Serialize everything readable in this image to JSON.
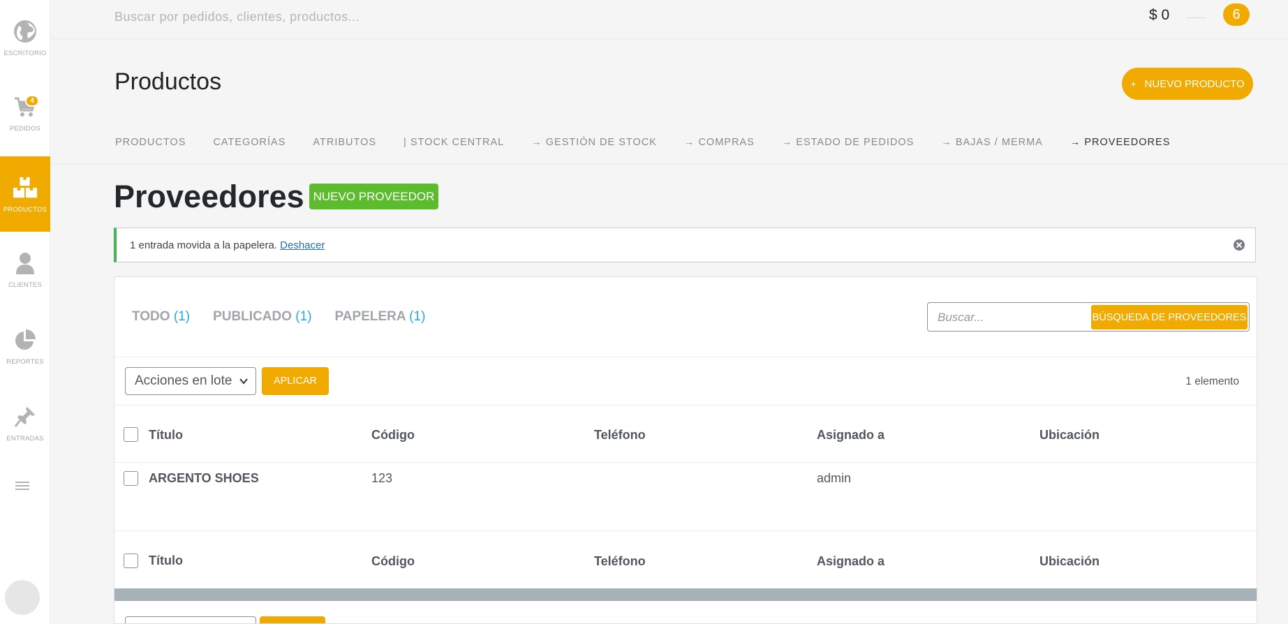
{
  "sidebar": {
    "items": [
      {
        "label": "Escritorio",
        "icon": "globe-icon"
      },
      {
        "label": "Pedidos",
        "icon": "cart-icon",
        "badge": "4"
      },
      {
        "label": "Productos",
        "icon": "boxes-icon",
        "active": true
      },
      {
        "label": "Clientes",
        "icon": "user-icon"
      },
      {
        "label": "Reportes",
        "icon": "pie-chart-icon"
      },
      {
        "label": "Entradas",
        "icon": "pin-icon"
      }
    ]
  },
  "topbar": {
    "search_placeholder": "Buscar por pedidos, clientes, productos...",
    "money": "$ 0",
    "count": "6"
  },
  "header": {
    "title": "Productos",
    "new_product_plus": "+",
    "new_product_label": "NUEVO PRODUCTO"
  },
  "subnav": {
    "items": [
      "PRODUCTOS",
      "CATEGORÍAS",
      "ATRIBUTOS",
      "| STOCK CENTRAL",
      "→ GESTIÓN DE STOCK",
      "→ COMPRAS",
      "→ ESTADO DE PEDIDOS",
      "→ BAJAS / MERMA",
      "→ PROVEEDORES"
    ]
  },
  "section": {
    "title": "Proveedores",
    "new_supplier_label": "NUEVO PROVEEDOR"
  },
  "notice": {
    "text": "1 entrada movida a la papelera.",
    "undo_label": "Deshacer"
  },
  "views": [
    {
      "label": "TODO",
      "count": "(1)"
    },
    {
      "label": "PUBLICADO",
      "count": "(1)"
    },
    {
      "label": "PAPELERA",
      "count": "(1)"
    }
  ],
  "search": {
    "placeholder": "Buscar...",
    "button_label": "BÚSQUEDA DE PROVEEDORES"
  },
  "bulk": {
    "selected": "Acciones en lote",
    "apply_label": "APLICAR",
    "item_count": "1 elemento"
  },
  "table": {
    "columns": [
      "Título",
      "Código",
      "Teléfono",
      "Asignado a",
      "Ubicación"
    ],
    "rows": [
      {
        "title": "ARGENTO SHOES",
        "code": "123",
        "phone": "",
        "assigned": "admin",
        "location": ""
      }
    ]
  },
  "colors": {
    "accent": "#f0aa00",
    "green": "#5cbc2e",
    "link": "#1eaae7"
  }
}
